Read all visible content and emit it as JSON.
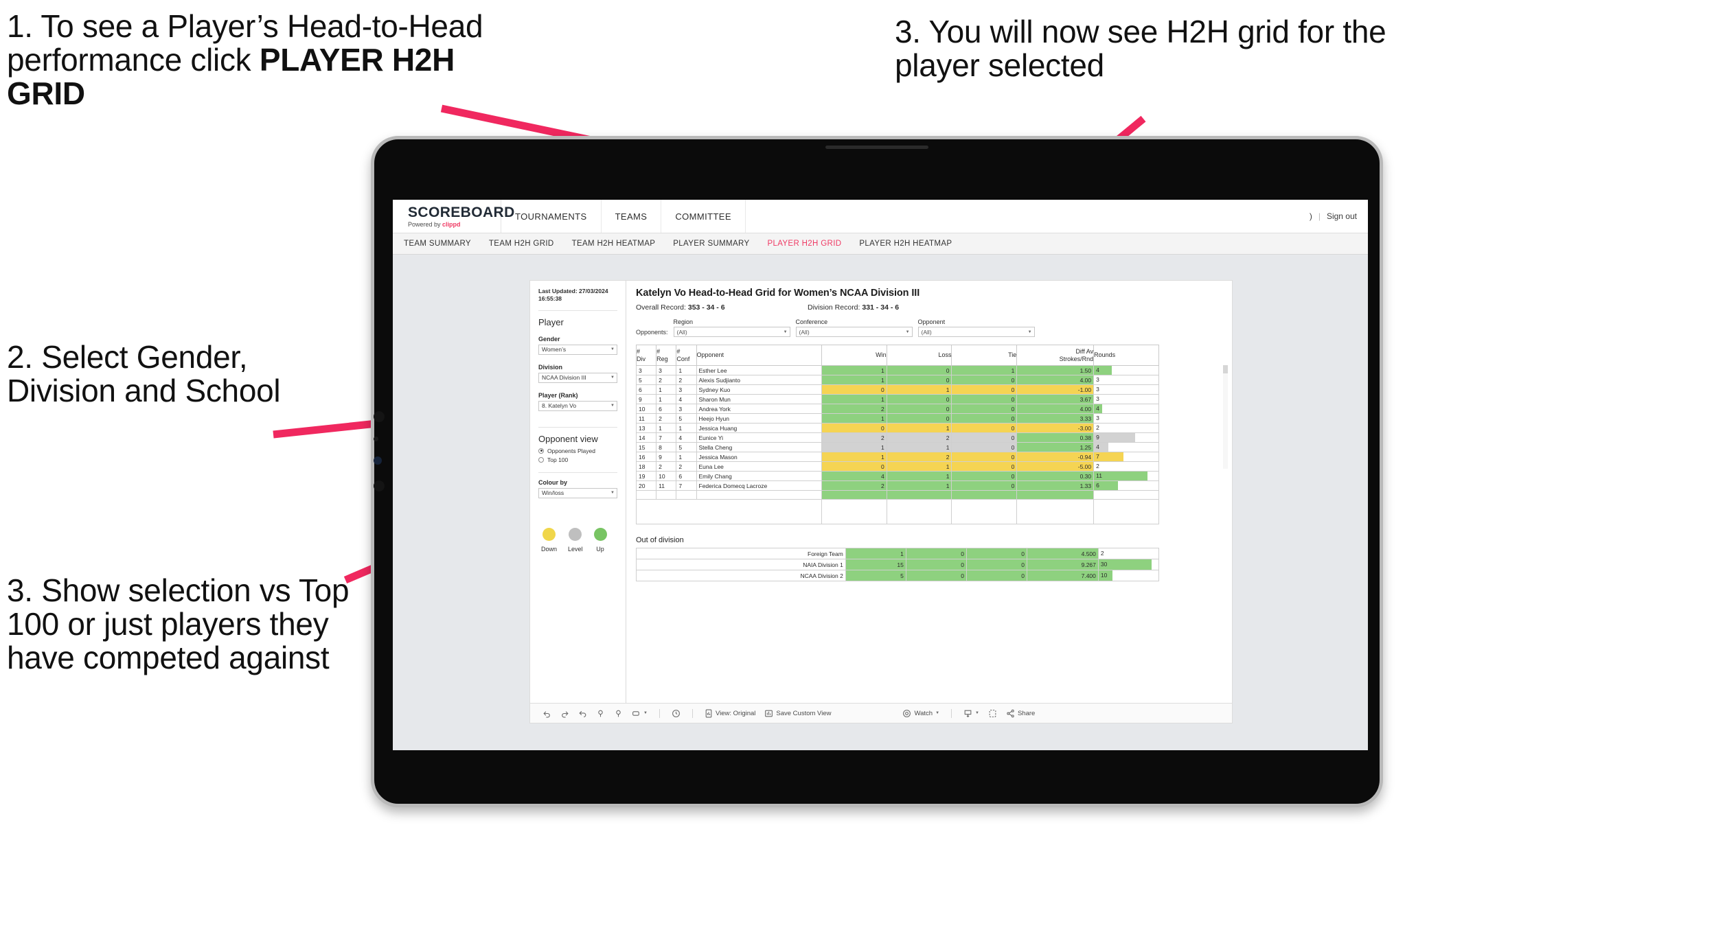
{
  "annotations": [
    {
      "id": "anno-1",
      "text_plain": "1. To see a Player’s Head-to-Head performance click ",
      "text_bold": "PLAYER H2H GRID"
    },
    {
      "id": "anno-2",
      "text": "2. Select Gender, Division and School"
    },
    {
      "id": "anno-3",
      "text": "3. Show selection vs Top 100 or just players they have competed against"
    },
    {
      "id": "anno-4",
      "text": "3. You will now see H2H grid for the player selected"
    }
  ],
  "accent_pink": "#F0285F",
  "app": {
    "brand": {
      "title": "SCOREBOARD",
      "sub_prefix": "Powered by ",
      "sub_brand": "clippd"
    },
    "topnav": [
      "TOURNAMENTS",
      "TEAMS",
      "COMMITTEE"
    ],
    "top_right": {
      "user": ")",
      "separator": "|",
      "sign_out": "Sign out"
    },
    "tabs": [
      {
        "label": "TEAM SUMMARY",
        "active": false
      },
      {
        "label": "TEAM H2H GRID",
        "active": false
      },
      {
        "label": "TEAM H2H HEATMAP",
        "active": false
      },
      {
        "label": "PLAYER SUMMARY",
        "active": false
      },
      {
        "label": "PLAYER H2H GRID",
        "active": true
      },
      {
        "label": "PLAYER H2H HEATMAP",
        "active": false
      }
    ]
  },
  "sidebar": {
    "last_updated": "Last Updated: 27/03/2024 16:55:38",
    "player_heading": "Player",
    "gender": {
      "label": "Gender",
      "value": "Women’s"
    },
    "division": {
      "label": "Division",
      "value": "NCAA Division III"
    },
    "player_rank": {
      "label": "Player (Rank)",
      "value": "8. Katelyn Vo"
    },
    "opponent_view": {
      "heading": "Opponent view",
      "options": [
        {
          "label": "Opponents Played",
          "selected": true
        },
        {
          "label": "Top 100",
          "selected": false
        }
      ]
    },
    "colour_by": {
      "label": "Colour by",
      "value": "Win/loss"
    },
    "legend": [
      {
        "label": "Down",
        "color": "#f0d64a"
      },
      {
        "label": "Level",
        "color": "#bfbfbf"
      },
      {
        "label": "Up",
        "color": "#78c463"
      }
    ]
  },
  "main": {
    "title": "Katelyn Vo Head-to-Head Grid for Women’s NCAA Division III",
    "overall_record_label": "Overall Record: ",
    "overall_record_value": "353 - 34 - 6",
    "division_record_label": "Division Record: ",
    "division_record_value": "331 - 34 - 6",
    "opponents_label": "Opponents:",
    "filters": [
      {
        "label": "Region",
        "value": "(All)"
      },
      {
        "label": "Conference",
        "value": "(All)"
      },
      {
        "label": "Opponent",
        "value": "(All)"
      }
    ],
    "columns": [
      "# Div",
      "# Reg",
      "# Conf",
      "Opponent",
      "Win",
      "Loss",
      "Tie",
      "Diff Av Strokes/Rnd",
      "Rounds"
    ],
    "rows": [
      {
        "div": "3",
        "reg": "3",
        "conf": "1",
        "opponent": "Esther Lee",
        "win": "1",
        "loss": "0",
        "tie": "1",
        "diff": "1.50",
        "rounds": "4",
        "color": "green",
        "bar_pct": 28
      },
      {
        "div": "5",
        "reg": "2",
        "conf": "2",
        "opponent": "Alexis Sudjianto",
        "win": "1",
        "loss": "0",
        "tie": "0",
        "diff": "4.00",
        "rounds": "3",
        "color": "green",
        "bar_pct": 0
      },
      {
        "div": "6",
        "reg": "1",
        "conf": "3",
        "opponent": "Sydney Kuo",
        "win": "0",
        "loss": "1",
        "tie": "0",
        "diff": "-1.00",
        "rounds": "3",
        "color": "yellow",
        "bar_pct": 0
      },
      {
        "div": "9",
        "reg": "1",
        "conf": "4",
        "opponent": "Sharon Mun",
        "win": "1",
        "loss": "0",
        "tie": "0",
        "diff": "3.67",
        "rounds": "3",
        "color": "green",
        "bar_pct": 0
      },
      {
        "div": "10",
        "reg": "6",
        "conf": "3",
        "opponent": "Andrea York",
        "win": "2",
        "loss": "0",
        "tie": "0",
        "diff": "4.00",
        "rounds": "4",
        "color": "green",
        "bar_pct": 13
      },
      {
        "div": "11",
        "reg": "2",
        "conf": "5",
        "opponent": "Heejo Hyun",
        "win": "1",
        "loss": "0",
        "tie": "0",
        "diff": "3.33",
        "rounds": "3",
        "color": "green",
        "bar_pct": 0
      },
      {
        "div": "13",
        "reg": "1",
        "conf": "1",
        "opponent": "Jessica Huang",
        "win": "0",
        "loss": "1",
        "tie": "0",
        "diff": "-3.00",
        "rounds": "2",
        "color": "yellow",
        "bar_pct": 0
      },
      {
        "div": "14",
        "reg": "7",
        "conf": "4",
        "opponent": "Eunice Yi",
        "win": "2",
        "loss": "2",
        "tie": "0",
        "diff": "0.38",
        "rounds": "9",
        "color": "grey",
        "bar_pct": 64,
        "diff_color": "green"
      },
      {
        "div": "15",
        "reg": "8",
        "conf": "5",
        "opponent": "Stella Cheng",
        "win": "1",
        "loss": "1",
        "tie": "0",
        "diff": "1.25",
        "rounds": "4",
        "color": "grey",
        "bar_pct": 22,
        "diff_color": "green"
      },
      {
        "div": "16",
        "reg": "9",
        "conf": "1",
        "opponent": "Jessica Mason",
        "win": "1",
        "loss": "2",
        "tie": "0",
        "diff": "-0.94",
        "rounds": "7",
        "color": "yellow",
        "bar_pct": 46
      },
      {
        "div": "18",
        "reg": "2",
        "conf": "2",
        "opponent": "Euna Lee",
        "win": "0",
        "loss": "1",
        "tie": "0",
        "diff": "-5.00",
        "rounds": "2",
        "color": "yellow",
        "bar_pct": 0
      },
      {
        "div": "19",
        "reg": "10",
        "conf": "6",
        "opponent": "Emily Chang",
        "win": "4",
        "loss": "1",
        "tie": "0",
        "diff": "0.30",
        "rounds": "11",
        "color": "green",
        "bar_pct": 83
      },
      {
        "div": "20",
        "reg": "11",
        "conf": "7",
        "opponent": "Federica Domecq Lacroze",
        "win": "2",
        "loss": "1",
        "tie": "0",
        "diff": "1.33",
        "rounds": "6",
        "color": "green",
        "bar_pct": 37
      }
    ],
    "out_of_division": {
      "title": "Out of division",
      "rows": [
        {
          "label": "Foreign Team",
          "win": "1",
          "loss": "0",
          "tie": "0",
          "diff": "4.500",
          "rounds": "2",
          "color": "green",
          "bar_pct": 0
        },
        {
          "label": "NAIA Division 1",
          "win": "15",
          "loss": "0",
          "tie": "0",
          "diff": "9.267",
          "rounds": "30",
          "color": "green",
          "bar_pct": 88
        },
        {
          "label": "NCAA Division 2",
          "win": "5",
          "loss": "0",
          "tie": "0",
          "diff": "7.400",
          "rounds": "10",
          "color": "green",
          "bar_pct": 23
        }
      ]
    }
  },
  "toolbar": {
    "view_original": "View: Original",
    "save_custom_view": "Save Custom View",
    "watch": "Watch",
    "share": "Share"
  }
}
